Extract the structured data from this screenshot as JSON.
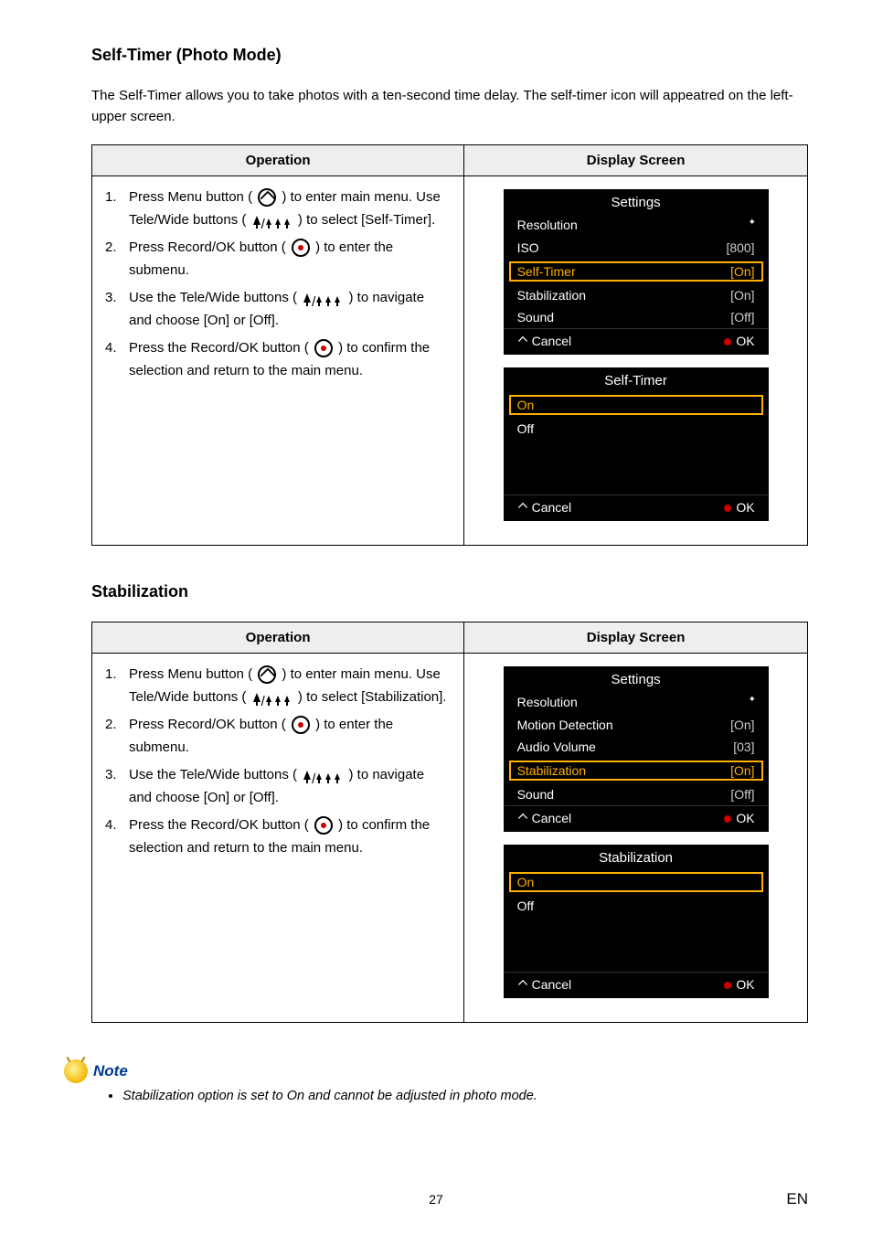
{
  "section1": {
    "heading": "Self-Timer (Photo Mode)",
    "intro": "The Self-Timer allows you to take photos with a ten-second time delay. The self-timer icon will appeatred on the left-upper screen.",
    "th_operation": "Operation",
    "th_display": "Display Screen",
    "steps": {
      "s1a": "Press Menu button ( ",
      "s1b": " ) to enter main menu. Use Tele/Wide buttons ( ",
      "s1c": " ) to select [Self-Timer].",
      "s2a": "Press Record/OK button ( ",
      "s2b": " ) to enter the submenu.",
      "s3a": "Use the Tele/Wide buttons ( ",
      "s3b": " ) to navigate and choose [On] or [Off].",
      "s4a": "Press the Record/OK button ( ",
      "s4b": " ) to confirm the selection and return to the main menu."
    },
    "screen1": {
      "title": "Settings",
      "rows": [
        {
          "label": "Resolution",
          "value": "✧"
        },
        {
          "label": "ISO",
          "value": "[800]"
        },
        {
          "label": "Self-Timer",
          "value": "[On]",
          "selected": true
        },
        {
          "label": "Stabilization",
          "value": "[On]"
        },
        {
          "label": "Sound",
          "value": "[Off]"
        }
      ],
      "cancel": "Cancel",
      "ok": "OK"
    },
    "screen2": {
      "title": "Self-Timer",
      "on": "On",
      "off": "Off",
      "cancel": "Cancel",
      "ok": "OK"
    }
  },
  "section2": {
    "heading": "Stabilization",
    "th_operation": "Operation",
    "th_display": "Display Screen",
    "steps": {
      "s1a": "Press Menu button ( ",
      "s1b": " ) to enter main menu. Use Tele/Wide buttons ( ",
      "s1c": " ) to select [Stabilization].",
      "s2a": "Press Record/OK button ( ",
      "s2b": " ) to enter the submenu.",
      "s3a": "Use the Tele/Wide buttons ( ",
      "s3b": " )  to navigate and choose [On] or [Off].",
      "s4a": "Press the Record/OK button ( ",
      "s4b": " ) to confirm the selection and return to the main menu."
    },
    "screen1": {
      "title": "Settings",
      "rows": [
        {
          "label": "Resolution",
          "value": "✧"
        },
        {
          "label": "Motion Detection",
          "value": "[On]"
        },
        {
          "label": "Audio Volume",
          "value": "[03]"
        },
        {
          "label": "Stabilization",
          "value": "[On]",
          "selected": true
        },
        {
          "label": "Sound",
          "value": "[Off]"
        }
      ],
      "cancel": "Cancel",
      "ok": "OK"
    },
    "screen2": {
      "title": "Stabilization",
      "on": "On",
      "off": "Off",
      "cancel": "Cancel",
      "ok": "OK"
    }
  },
  "note": {
    "label": "Note",
    "item": "Stabilization option is set to On and cannot be adjusted in photo mode."
  },
  "pagenum": "27",
  "lang": "EN"
}
